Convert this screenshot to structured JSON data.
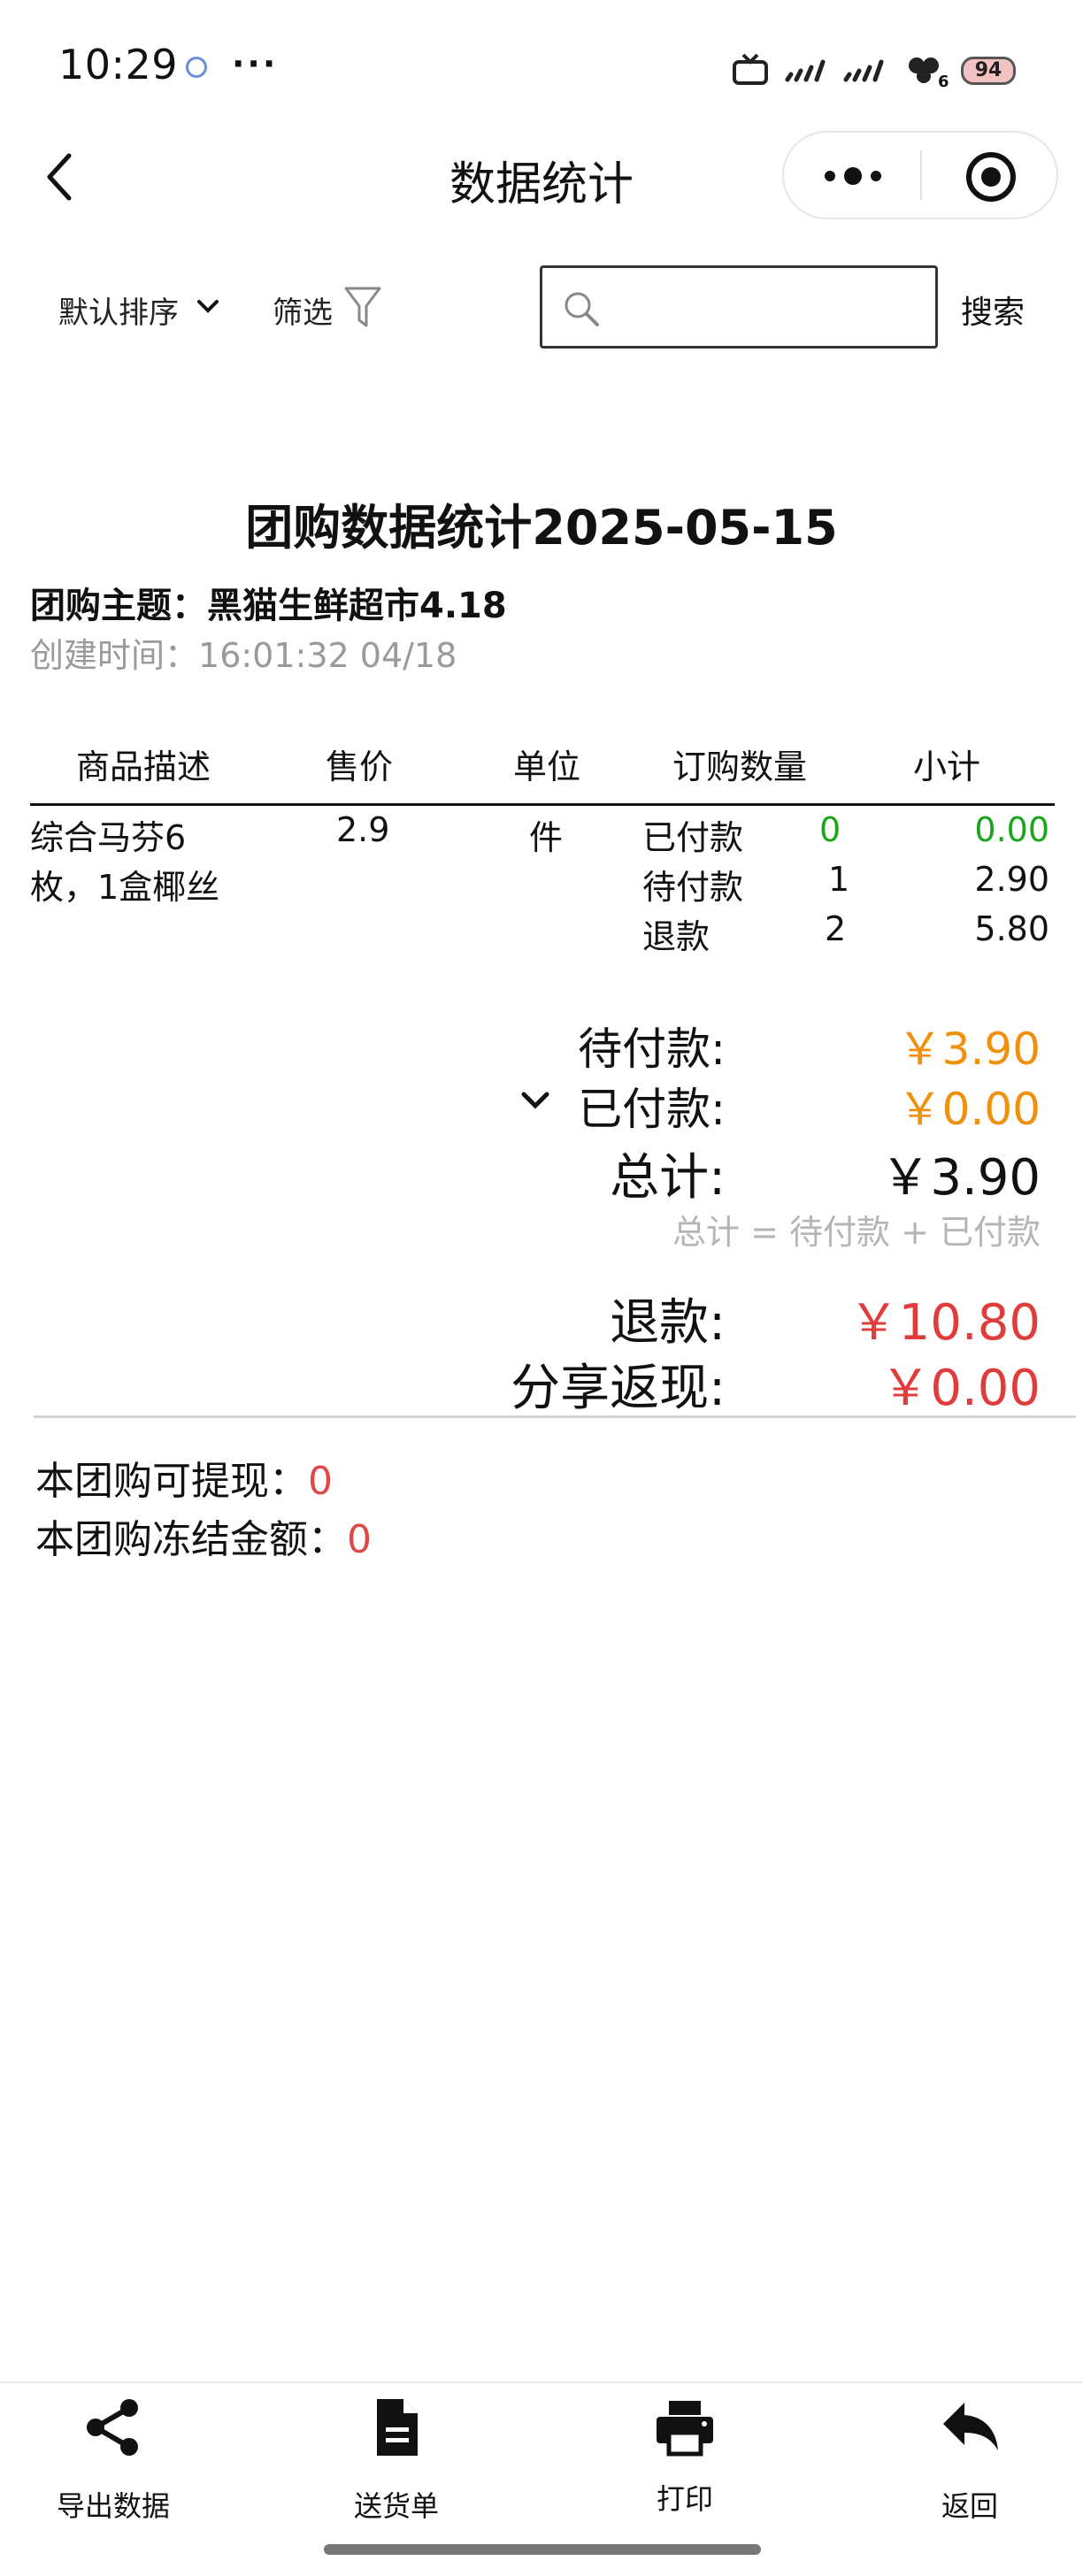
{
  "status_bar": {
    "time": "10:29",
    "dots": "···",
    "battery": "94",
    "signal_sub": "6"
  },
  "nav": {
    "title": "数据统计",
    "capsule_more": "•●•"
  },
  "filter_bar": {
    "sort_label": "默认排序",
    "filter_label": "筛选",
    "search_placeholder": "",
    "search_button": "搜索"
  },
  "report": {
    "title": "团购数据统计2025-05-15",
    "theme_label": "团购主题：",
    "theme_value": "黑猫生鲜超市4.18",
    "created_label": "创建时间：",
    "created_value": "16:01:32 04/18",
    "columns": [
      "商品描述",
      "售价",
      "单位",
      "订购数量",
      "小计"
    ],
    "product": {
      "description_line1": "综合马芬6",
      "description_line2": "枚，1盒椰丝",
      "price": "2.9",
      "unit": "件",
      "rows": [
        {
          "status": "已付款",
          "qty": "0",
          "subtotal": "0.00"
        },
        {
          "status": "待付款",
          "qty": "1",
          "subtotal": "2.90"
        },
        {
          "status": "退款",
          "qty": "2",
          "subtotal": "5.80"
        }
      ]
    },
    "summary": {
      "pending_label": "待付款:",
      "pending_value": "￥3.90",
      "paid_label": "已付款:",
      "paid_value": "￥0.00",
      "total_label": "总计:",
      "total_value": "￥3.90",
      "formula": "总计 = 待付款 + 已付款",
      "refund_label": "退款:",
      "refund_value": "￥10.80",
      "cashback_label": "分享返现:",
      "cashback_value": "￥0.00"
    },
    "withdrawable_label": "本团购可提现：",
    "withdrawable_value": "0",
    "frozen_label": "本团购冻结金额：",
    "frozen_value": "0"
  },
  "bottom_tabs": [
    {
      "label": "导出数据",
      "icon": "share-icon"
    },
    {
      "label": "送货单",
      "icon": "document-icon"
    },
    {
      "label": "打印",
      "icon": "print-icon"
    },
    {
      "label": "返回",
      "icon": "reply-icon"
    }
  ],
  "colors": {
    "green": "#1aa51a",
    "orange": "#f0900c",
    "red": "#e03c3c"
  }
}
